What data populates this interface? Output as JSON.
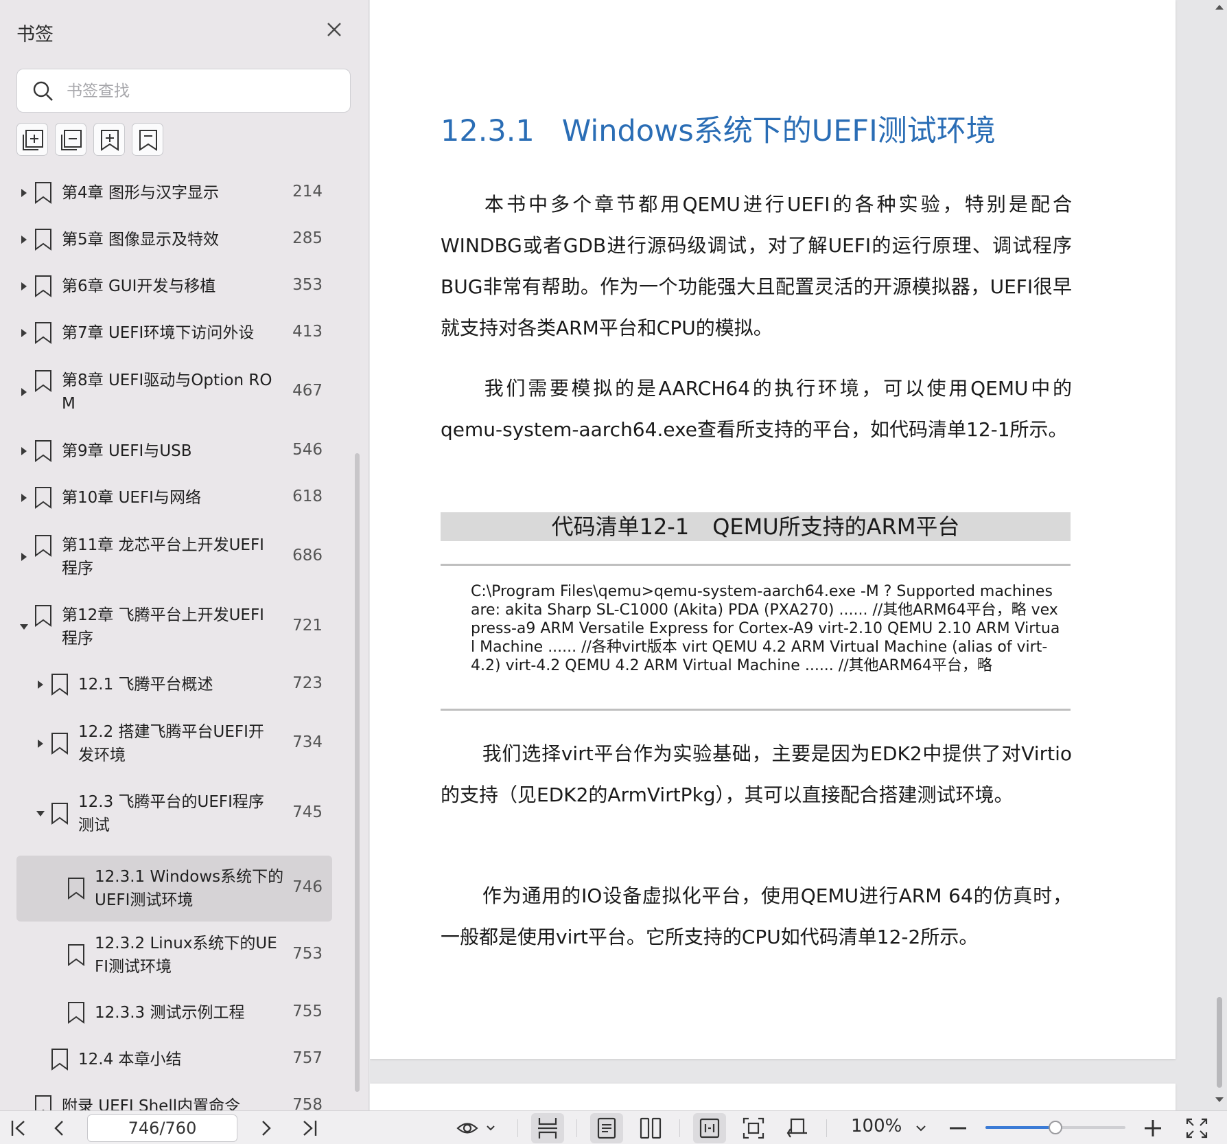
{
  "sidebar": {
    "title": "书签",
    "search_placeholder": "书签查找",
    "items": [
      {
        "l1": "第4章 图形与汉字显示",
        "l2": "",
        "page": "214",
        "expanded": false
      },
      {
        "l1": "第5章 图像显示及特效",
        "l2": "",
        "page": "285",
        "expanded": false
      },
      {
        "l1": "第6章 GUI开发与移植",
        "l2": "",
        "page": "353",
        "expanded": false
      },
      {
        "l1": "第7章 UEFI环境下访问外设",
        "l2": "",
        "page": "413",
        "expanded": false
      },
      {
        "l1": "第8章 UEFI驱动与Option RO",
        "l2": "M",
        "page": "467",
        "expanded": false
      },
      {
        "l1": "第9章 UEFI与USB",
        "l2": "",
        "page": "546",
        "expanded": false
      },
      {
        "l1": "第10章 UEFI与网络",
        "l2": "",
        "page": "618",
        "expanded": false
      },
      {
        "l1": "第11章 龙芯平台上开发UEFI",
        "l2": "程序",
        "page": "686",
        "expanded": false
      },
      {
        "l1": "第12章 飞腾平台上开发UEFI",
        "l2": "程序",
        "page": "721",
        "expanded": true
      },
      {
        "l1": "12.1 飞腾平台概述",
        "l2": "",
        "page": "723",
        "expanded": false
      },
      {
        "l1": "12.2 搭建飞腾平台UEFI开",
        "l2": "发环境",
        "page": "734",
        "expanded": false
      },
      {
        "l1": "12.3 飞腾平台的UEFI程序",
        "l2": "测试",
        "page": "745",
        "expanded": true
      },
      {
        "l1": "12.3.1 Windows系统下的",
        "l2": "UEFI测试环境",
        "page": "746",
        "expanded": false
      },
      {
        "l1": "12.3.2 Linux系统下的UE",
        "l2": "FI测试环境",
        "page": "753",
        "expanded": false
      },
      {
        "l1": "12.3.3 测试示例工程",
        "l2": "",
        "page": "755",
        "expanded": false
      },
      {
        "l1": "12.4 本章小结",
        "l2": "",
        "page": "757",
        "expanded": false
      },
      {
        "l1": "附录 UEFI Shell内置命令",
        "l2": "",
        "page": "758",
        "expanded": false
      }
    ]
  },
  "document": {
    "heading_num": "12.3.1",
    "heading_text": "Windows系统下的UEFI测试环境",
    "para1": "本书中多个章节都用QEMU进行UEFI的各种实验，特别是配合WINDBG或者GDB进行源码级调试，对了解UEFI的运行原理、调试程序BUG非常有帮助。作为一个功能强大且配置灵活的开源模拟器，UEFI很早就支持对各类ARM平台和CPU的模拟。",
    "para2": "我们需要模拟的是AARCH64的执行环境，可以使用QEMU中的qemu-system-aarch64.exe查看所支持的平台，如代码清单12-1所示。",
    "code_caption_num": "代码清单12-1",
    "code_caption_text": "QEMU所支持的ARM平台",
    "code": "C:\\Program Files\\qemu>qemu-system-aarch64.exe -M ? Supported machines are: akita              Sharp SL-C1000 (Akita) PDA (PXA270) ......              //其他ARM64平台，略 vexpress-a9          ARM Versatile Express for Cortex-A9 virt-2.10           QEMU 2.10 ARM Virtual Machine ......              //各种virt版本 virt QEMU 4.2 ARM Virtual Machine (alias of virt-4.2) virt-4.2              QEMU 4.2 ARM Virtual Machine ......              //其他ARM64平台，略",
    "para3": "我们选择virt平台作为实验基础，主要是因为EDK2中提供了对Virtio的支持（见EDK2的ArmVirtPkg），其可以直接配合搭建测试环境。",
    "para4": "作为通用的IO设备虚拟化平台，使用QEMU进行ARM 64的仿真时，一般都是使用virt平台。它所支持的CPU如代码清单12-2所示。"
  },
  "toolbar": {
    "page_indicator": "746/760",
    "zoom": "100%",
    "zoom_level": 0.5,
    "accent_color": "#3b7bd6",
    "icons": [
      "first-page-icon",
      "prev-page-icon",
      "next-page-icon",
      "last-page-icon",
      "eye-icon",
      "chevron-down-icon",
      "continuous-scroll-icon",
      "single-page-icon",
      "double-page-icon",
      "fit-width-icon",
      "fit-page-icon",
      "rotate-icon",
      "zoom-out-icon",
      "zoom-in-icon",
      "fullscreen-icon"
    ]
  }
}
